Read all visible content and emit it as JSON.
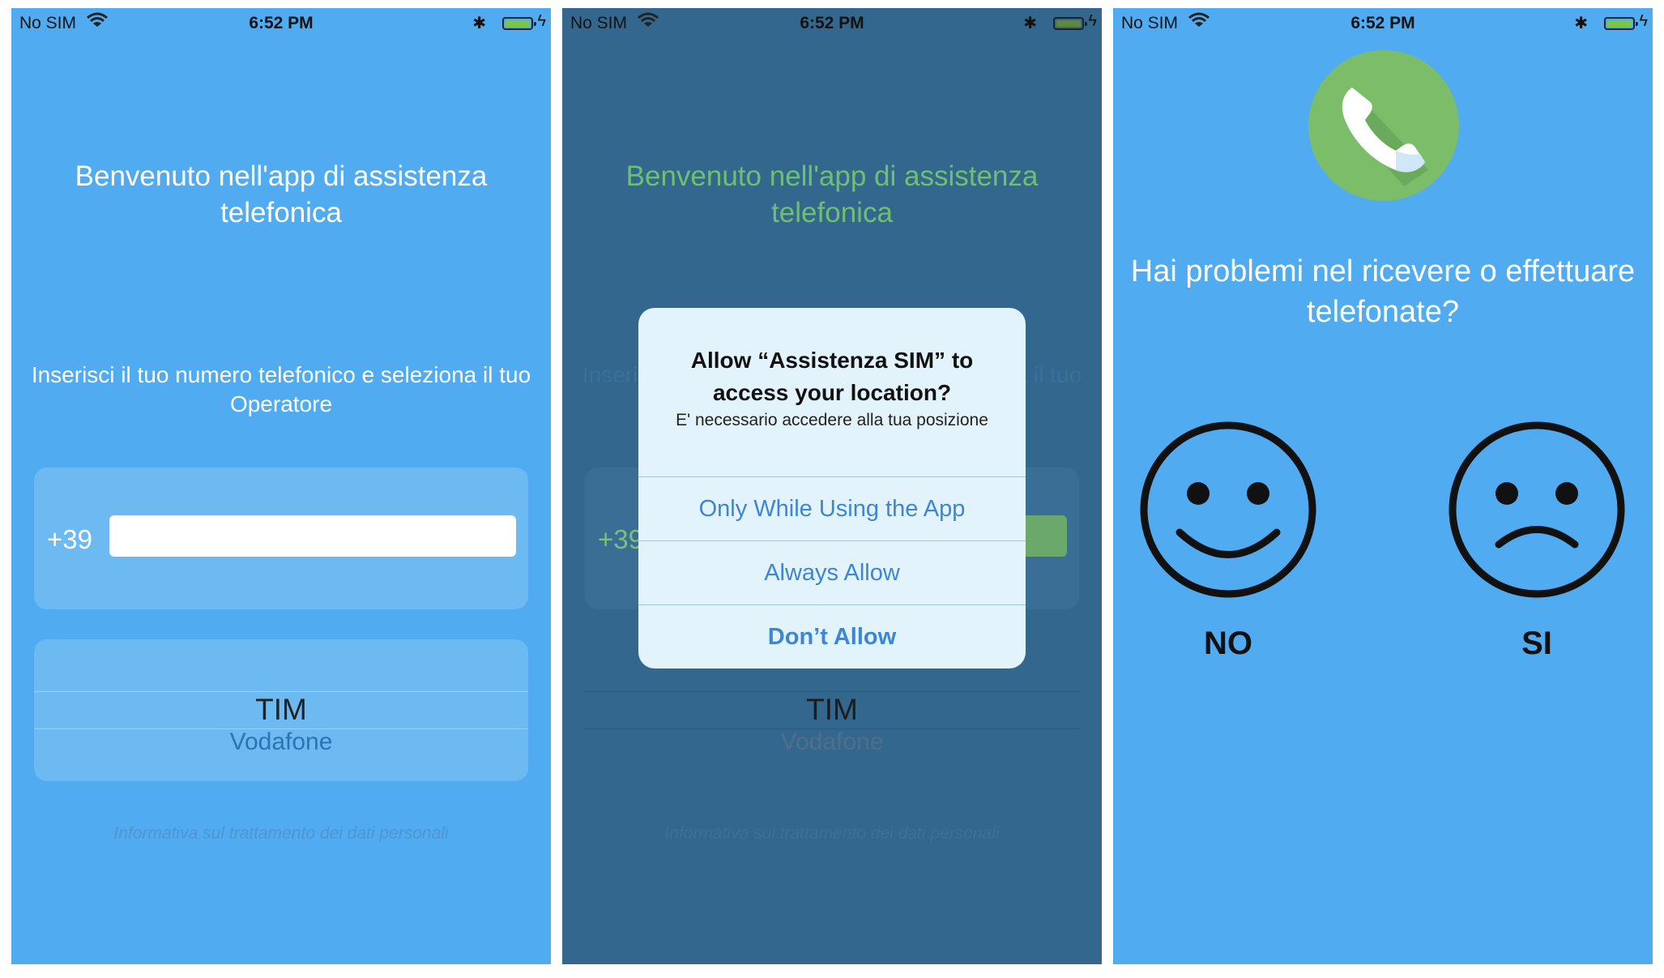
{
  "status_bar": {
    "carrier": "No SIM",
    "time": "6:52 PM"
  },
  "login": {
    "welcome": "Benvenuto nell'app di assistenza telefonica",
    "instruction": "Inserisci il tuo numero telefonico e seleziona il tuo Operatore",
    "prefix": "+39",
    "phone_value": "",
    "operators": [
      "TIM",
      "Vodafone"
    ],
    "selected_operator": "TIM",
    "privacy_link": "Informativa sul trattamento dei dati personali"
  },
  "alert": {
    "title": "Allow “Assistenza SIM” to access your location?",
    "message": "E' necessario accedere alla tua posizione",
    "buttons": [
      "Only While Using the App",
      "Always Allow",
      "Don’t Allow"
    ]
  },
  "survey": {
    "question": "Hai problemi nel ricevere o effettuare telefonate?",
    "options": [
      {
        "label": "NO",
        "face": "happy-face-icon"
      },
      {
        "label": "SI",
        "face": "sad-face-icon"
      }
    ]
  },
  "colors": {
    "background": "#50abf0",
    "dimmed_background": "#33678e",
    "call_icon": "#7cbd6a",
    "alert_button": "#3d86d6"
  }
}
